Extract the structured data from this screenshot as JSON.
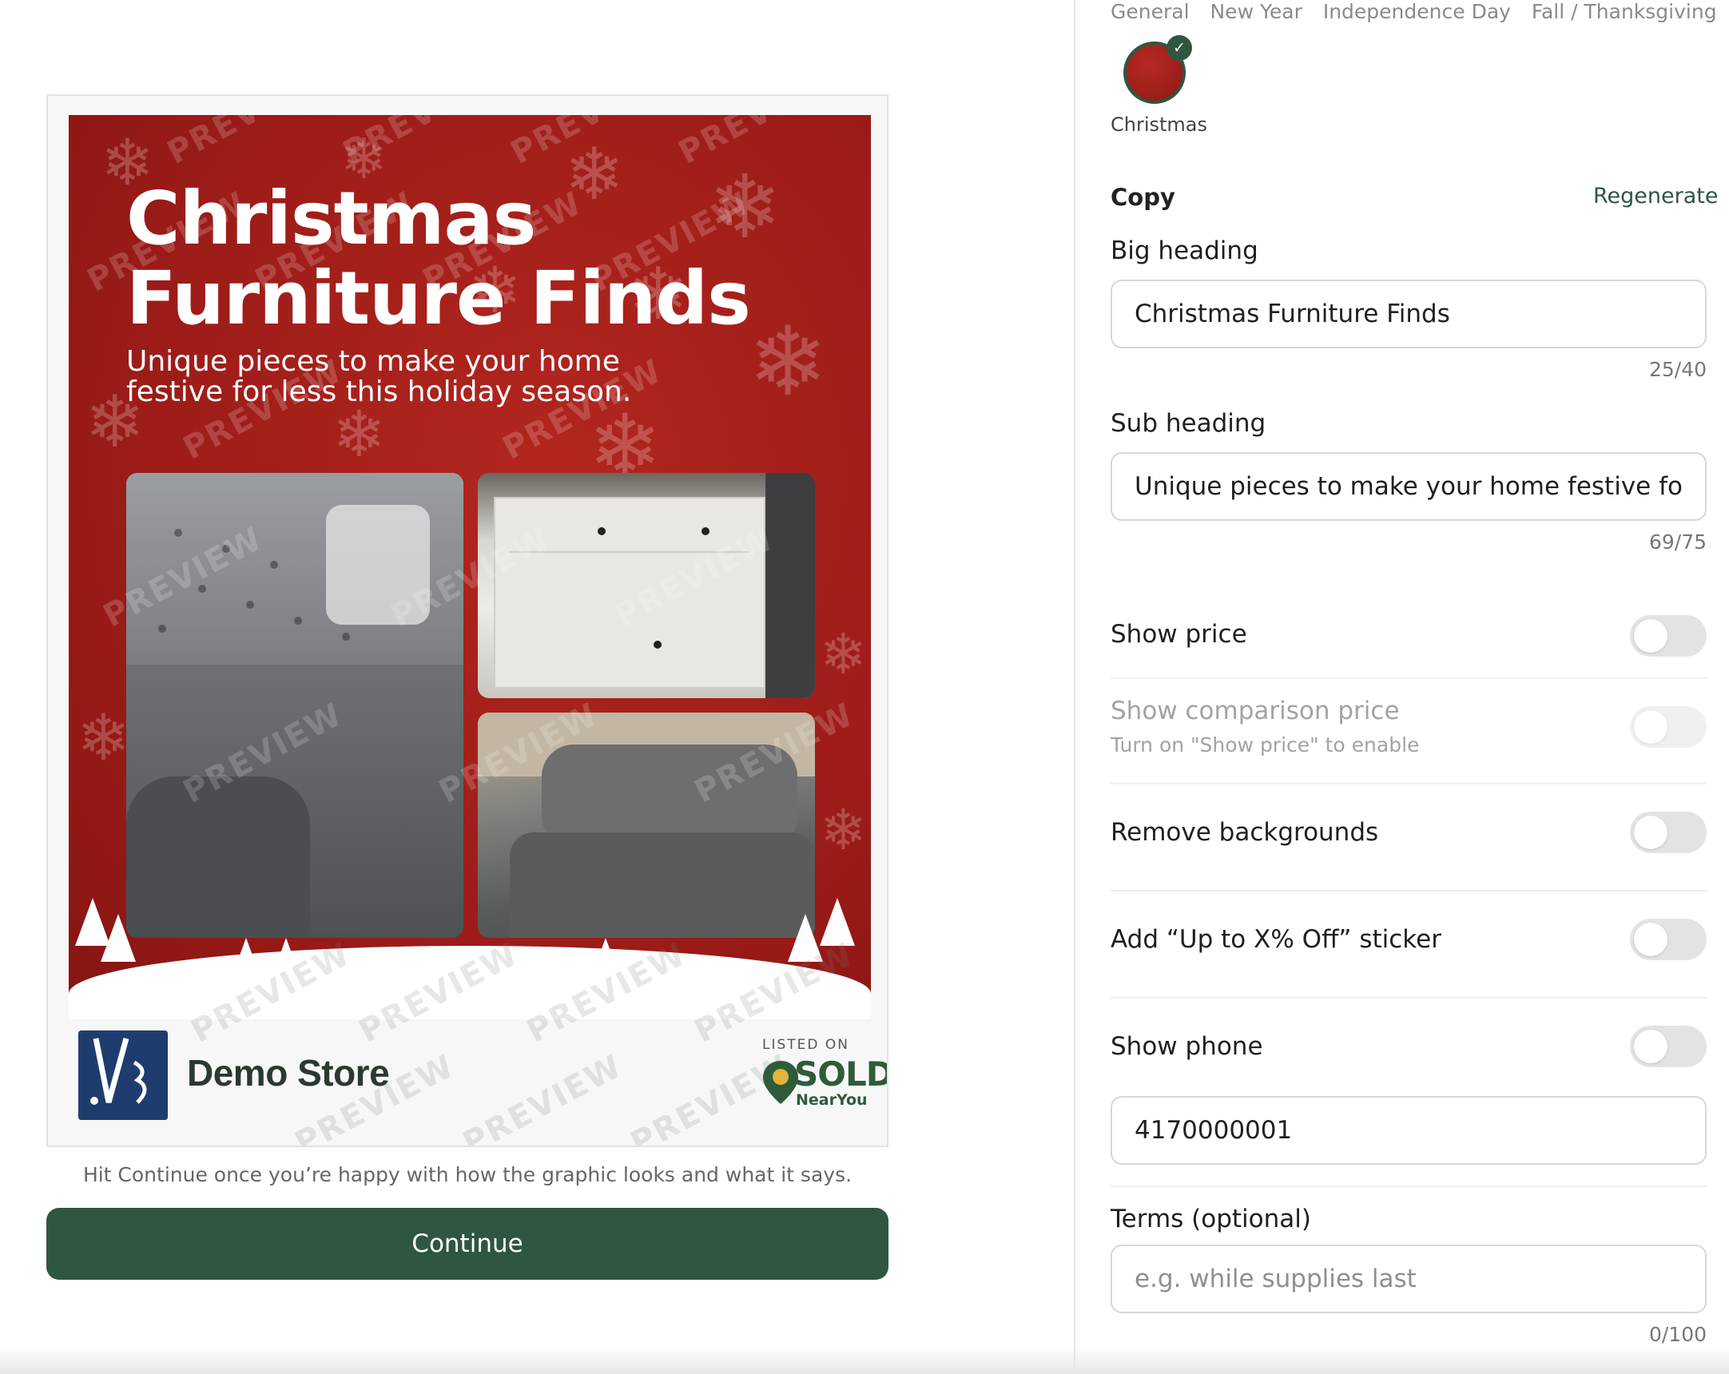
{
  "preview": {
    "heading": "Christmas Furniture Finds",
    "subheading": "Unique pieces to make your home festive for less this holiday season.",
    "watermark": "PREVIEW",
    "store_name": "Demo Store",
    "listed_on": "LISTED ON",
    "brand_word": "SOLD",
    "brand_sub": "NearYou",
    "hint": "Hit Continue once you’re happy with how the graphic looks and what it says.",
    "continue_label": "Continue",
    "theme_colors": {
      "background": "#9c1c18",
      "accent": "#2f5641"
    }
  },
  "panel": {
    "theme_tabs": [
      "General",
      "New Year",
      "Independence Day",
      "Fall / Thanksgiving"
    ],
    "selected_theme": "Christmas",
    "copy_title": "Copy",
    "regenerate_label": "Regenerate",
    "big_heading": {
      "label": "Big heading",
      "value": "Christmas Furniture Finds",
      "counter": "25/40"
    },
    "sub_heading": {
      "label": "Sub heading",
      "value": "Unique pieces to make your home festive for less this holiday season.",
      "counter": "69/75"
    },
    "toggles": {
      "show_price": {
        "label": "Show price",
        "on": false
      },
      "show_comparison_price": {
        "label": "Show comparison price",
        "hint": "Turn on \"Show price\" to enable",
        "on": false,
        "disabled": true
      },
      "remove_backgrounds": {
        "label": "Remove backgrounds",
        "on": false
      },
      "sticker": {
        "label": "Add “Up to X% Off” sticker",
        "on": false
      },
      "show_phone": {
        "label": "Show phone",
        "on": false
      }
    },
    "phone_value": "4170000001",
    "terms": {
      "label": "Terms (optional)",
      "placeholder": "e.g. while supplies last",
      "counter": "0/100"
    }
  }
}
